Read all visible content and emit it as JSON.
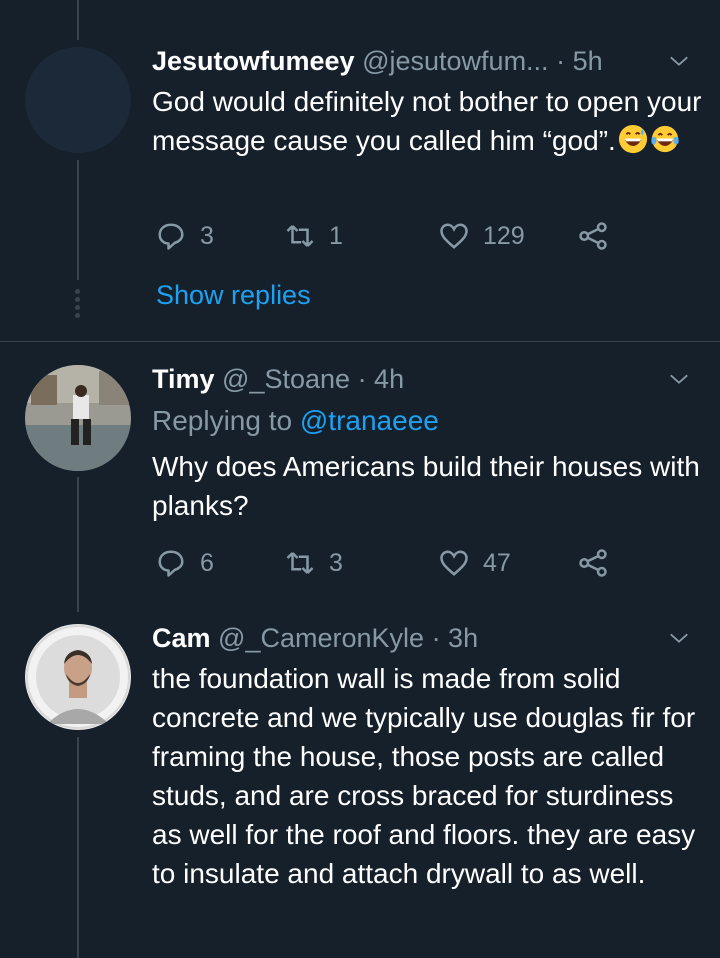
{
  "tweets": [
    {
      "name": "Jesutowfumeey",
      "handle": "@jesutowfum...",
      "time": "· 5h",
      "text": "God would definitely not bother to open your message cause you called him “god”.",
      "emojis": [
        "grinning-sweat-emoji",
        "tears-of-joy-emoji"
      ],
      "replies": "3",
      "retweets": "1",
      "likes": "129",
      "show_replies": "Show replies"
    },
    {
      "name": "Timy",
      "handle": "@_Stoane",
      "time": "· 4h",
      "replying_prefix": "Replying to",
      "replying_handle": "@tranaeee",
      "text": "Why does Americans build their houses with planks?",
      "replies": "6",
      "retweets": "3",
      "likes": "47"
    },
    {
      "name": "Cam",
      "handle": "@_CameronKyle",
      "time": "· 3h",
      "text": "the foundation wall is made from solid concrete and we typically use douglas fir for framing the house, those posts are called studs, and are cross braced for sturdiness as well for the roof and floors. they are easy to insulate and attach drywall to as well."
    }
  ],
  "colors": {
    "background": "#15202b",
    "secondary_text": "#8899a6",
    "link": "#1da1f2",
    "divider": "#38444d"
  }
}
